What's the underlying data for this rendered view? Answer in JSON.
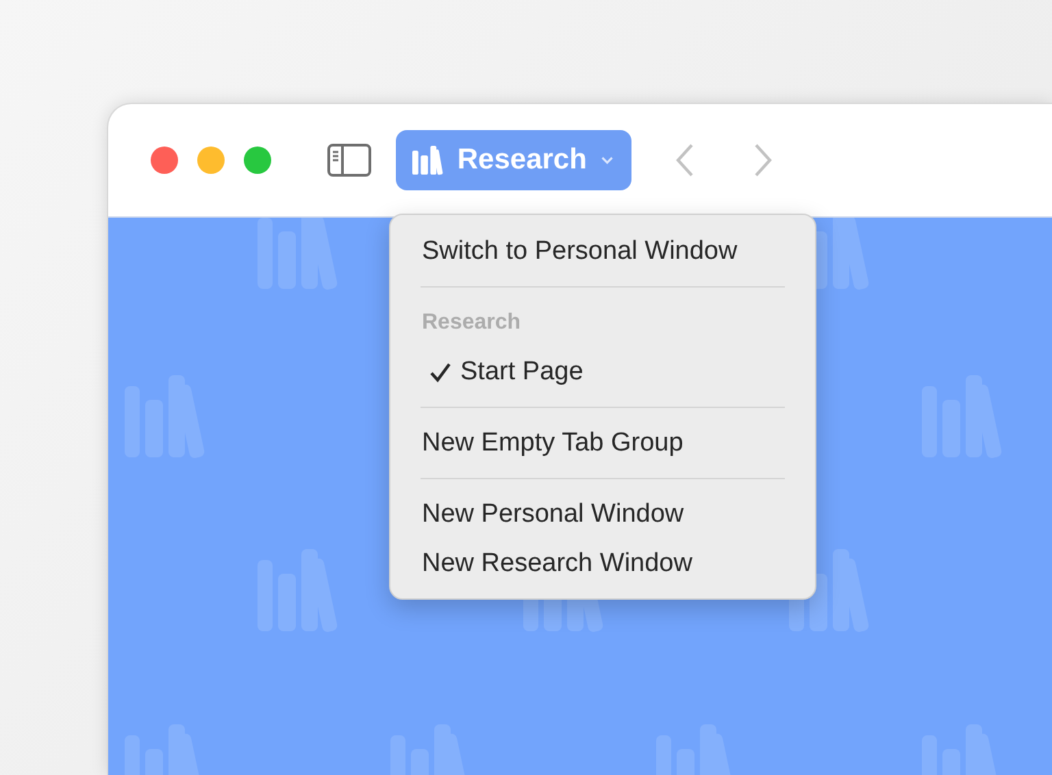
{
  "window": {
    "traffic_lights": [
      {
        "kind": "close"
      },
      {
        "kind": "minimize"
      },
      {
        "kind": "zoom"
      }
    ]
  },
  "toolbar": {
    "tab_group": {
      "label": "Research",
      "expanded": true
    },
    "nav_buttons": [
      {
        "kind": "back",
        "disabled": true
      },
      {
        "kind": "forward",
        "disabled": true
      }
    ]
  },
  "menu": {
    "entries": [
      {
        "kind": "item",
        "label": "Switch to Personal Window",
        "checked": false
      },
      {
        "kind": "separator"
      },
      {
        "kind": "header",
        "label": "Research"
      },
      {
        "kind": "item",
        "label": "Start Page",
        "checked": true
      },
      {
        "kind": "separator"
      },
      {
        "kind": "item",
        "label": "New Empty Tab Group",
        "checked": false
      },
      {
        "kind": "separator"
      },
      {
        "kind": "item",
        "label": "New Personal Window",
        "checked": false
      },
      {
        "kind": "item",
        "label": "New Research Window",
        "checked": false
      }
    ]
  }
}
